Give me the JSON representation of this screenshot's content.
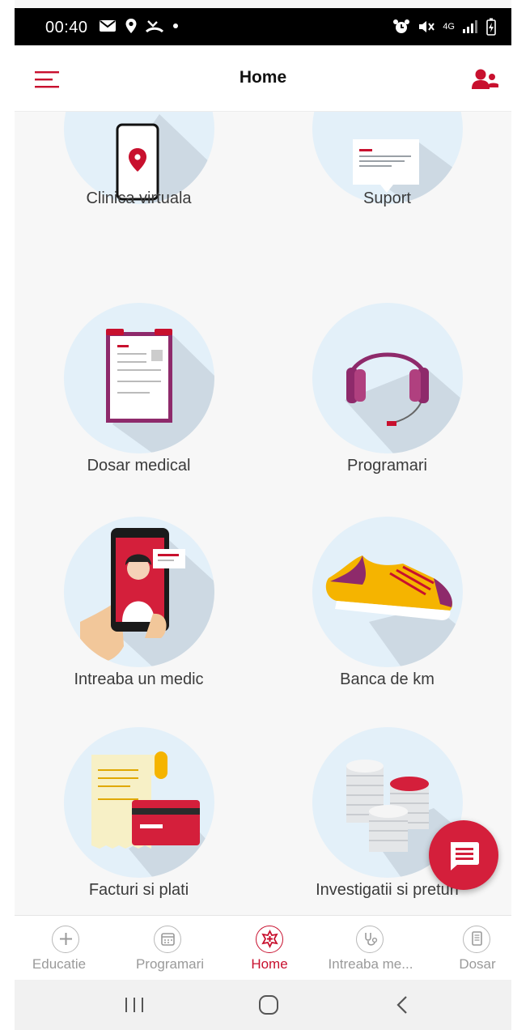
{
  "status_bar": {
    "time": "00:40",
    "network_label": "4G"
  },
  "header": {
    "title": "Home"
  },
  "tiles": [
    {
      "label": "Clinica virtuala"
    },
    {
      "label": "Suport"
    },
    {
      "label": "Dosar medical"
    },
    {
      "label": "Programari"
    },
    {
      "label": "Intreaba un medic"
    },
    {
      "label": "Banca de km"
    },
    {
      "label": "Facturi si plati"
    },
    {
      "label": "Investigatii si preturi"
    }
  ],
  "bottom_nav": [
    {
      "label": "Educatie",
      "icon": "plus-icon"
    },
    {
      "label": "Programari",
      "icon": "calendar-icon"
    },
    {
      "label": "Home",
      "icon": "home-cross-icon",
      "active": true
    },
    {
      "label": "Intreaba me...",
      "icon": "stethoscope-icon"
    },
    {
      "label": "Dosar",
      "icon": "document-icon"
    }
  ],
  "colors": {
    "accent": "#c8102e",
    "tile_circle": "#e3f0f9",
    "fab": "#d41f3b"
  }
}
